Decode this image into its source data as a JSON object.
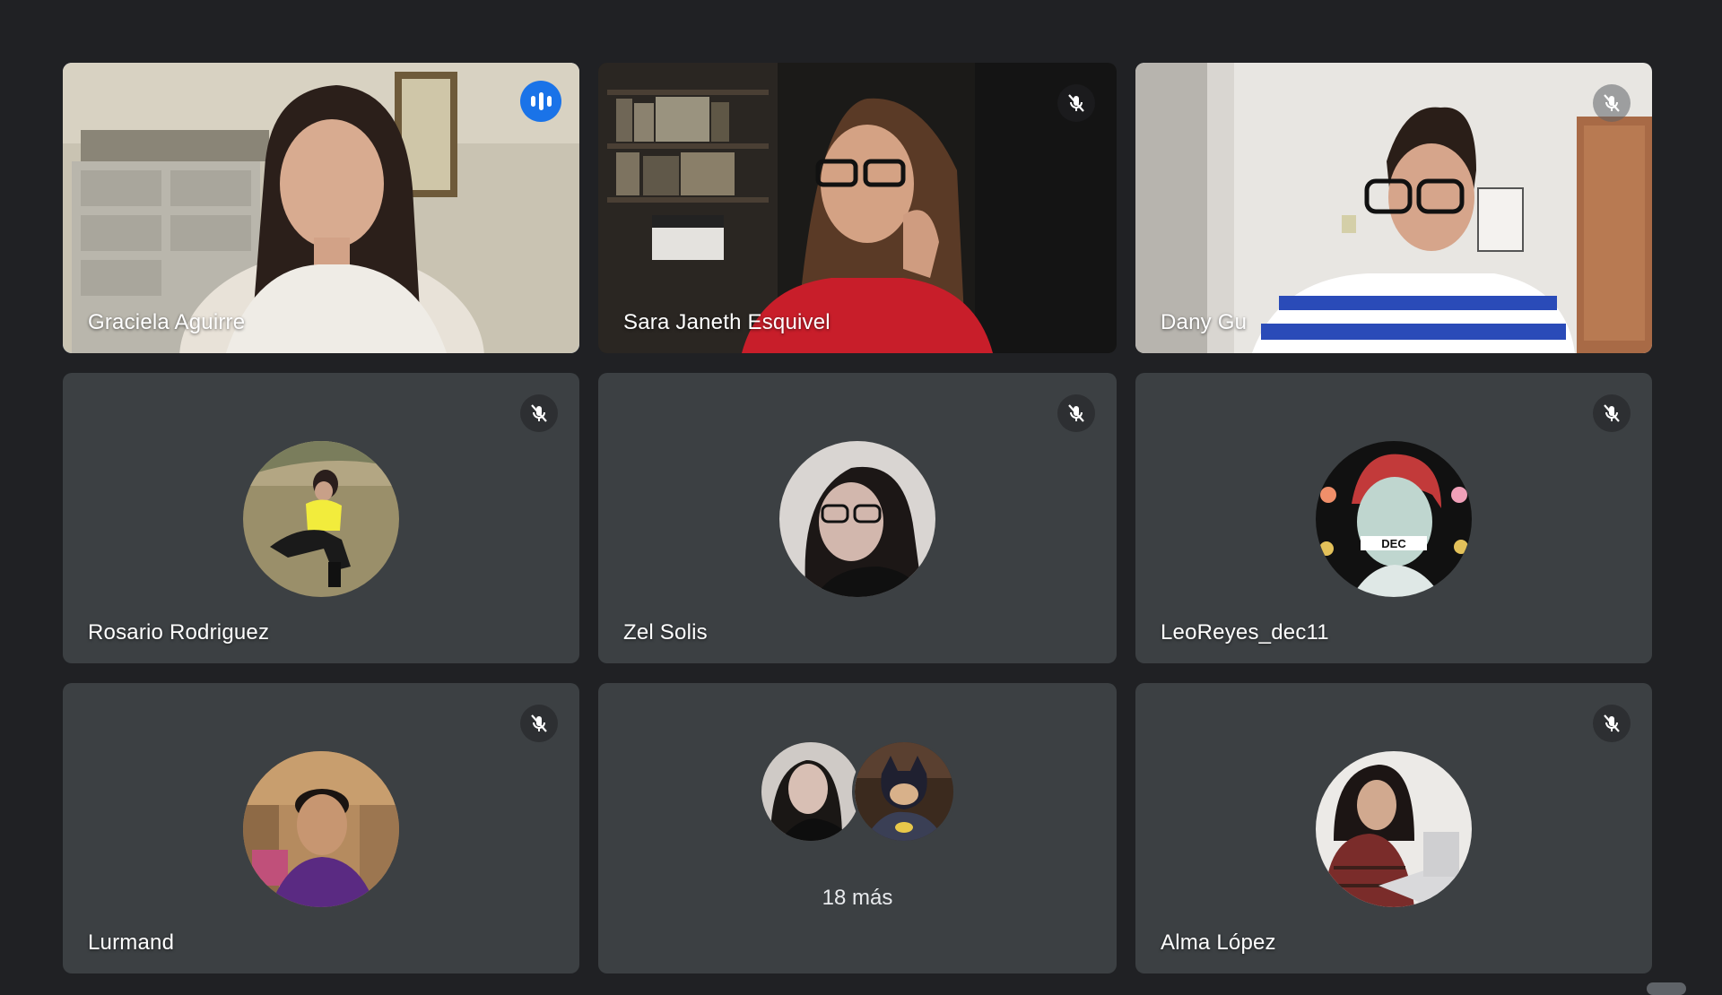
{
  "meeting": {
    "active_speaker_color": "#8ab4f8",
    "speaking_badge_color": "#1a73e8",
    "tile_color": "#3c4043",
    "background_color": "#202124"
  },
  "participants": [
    {
      "name": "Graciela Aguirre",
      "type": "video",
      "speaking": true,
      "icon": "speaking-indicator-icon"
    },
    {
      "name": "Sara Janeth Esquivel",
      "type": "video",
      "muted": true,
      "icon": "mic-off-icon"
    },
    {
      "name": "Dany Gu",
      "type": "video",
      "muted": true,
      "icon": "mic-off-icon"
    },
    {
      "name": "Rosario Rodriguez",
      "type": "avatar",
      "muted": true,
      "icon": "mic-off-icon"
    },
    {
      "name": "Zel Solis",
      "type": "avatar",
      "muted": true,
      "icon": "mic-off-icon"
    },
    {
      "name": "LeoReyes_dec11",
      "type": "avatar",
      "muted": true,
      "icon": "mic-off-icon"
    },
    {
      "name": "Lurmand",
      "type": "avatar",
      "muted": true,
      "icon": "mic-off-icon"
    },
    {
      "name": "Alma López",
      "type": "avatar",
      "muted": true,
      "icon": "mic-off-icon"
    }
  ],
  "overflow_tile": {
    "label": "18 más"
  },
  "avatar_badges": {
    "leo": "DEC"
  }
}
